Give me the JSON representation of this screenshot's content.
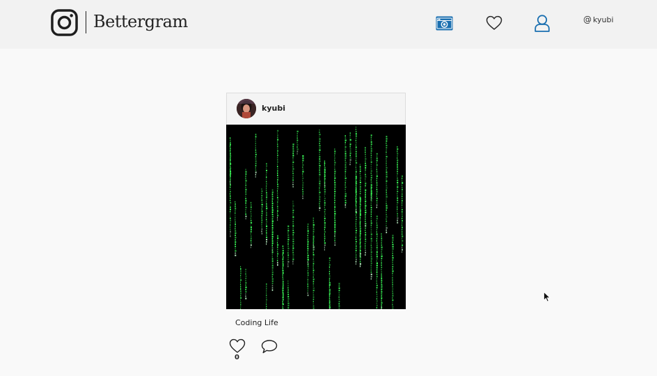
{
  "header": {
    "brand": "Bettergram",
    "logo_icon": "instagram-logo-icon",
    "nav": [
      {
        "name": "camera-icon",
        "color": "#1a6fb0"
      },
      {
        "name": "heart-icon"
      },
      {
        "name": "user-icon",
        "color": "#1a6fb0"
      }
    ],
    "handle_prefix": "@",
    "handle": "kyubi"
  },
  "post": {
    "username": "kyubi",
    "image_description_icon": "matrix-image",
    "caption": "Coding Life",
    "likes": "0",
    "like_icon": "heart-icon",
    "comment_icon": "speech-bubble-icon"
  },
  "colors": {
    "accent": "#1a6fb0",
    "matrix_green": "#3cff5a"
  }
}
